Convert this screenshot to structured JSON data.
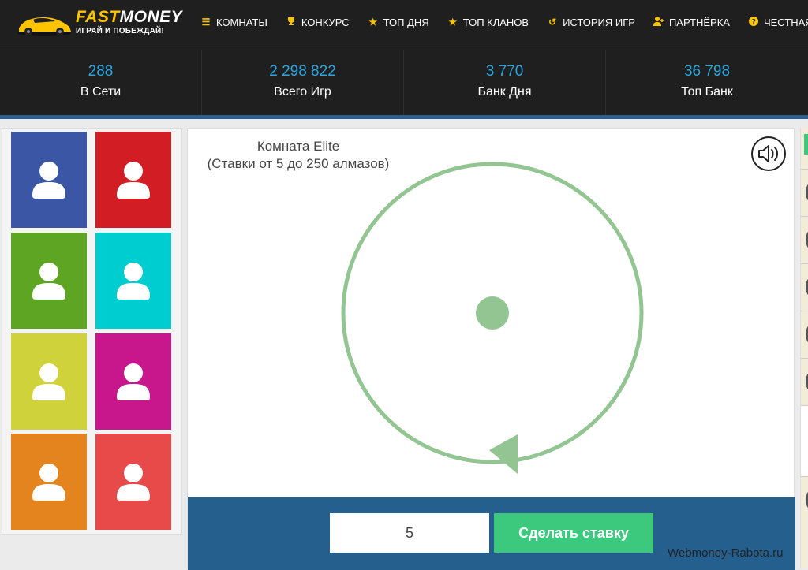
{
  "header": {
    "logo_title_a": "FAST",
    "logo_title_b": "MONEY",
    "logo_subtitle": "ИГРАЙ И ПОБЕЖДАЙ!",
    "nav": [
      {
        "label": "КОМНАТЫ",
        "icon": "menu-icon"
      },
      {
        "label": "КОНКУРС",
        "icon": "trophy-icon"
      },
      {
        "label": "ТОП ДНЯ",
        "icon": "star-icon"
      },
      {
        "label": "ТОП КЛАНОВ",
        "icon": "star-icon"
      },
      {
        "label": "ИСТОРИЯ ИГР",
        "icon": "history-icon"
      },
      {
        "label": "ПАРТНЁРКА",
        "icon": "user-plus-icon"
      },
      {
        "label": "ЧЕСТНАЯ",
        "icon": "question-icon"
      }
    ]
  },
  "stats": [
    {
      "value": "288",
      "label": "В Сети"
    },
    {
      "value": "2 298 822",
      "label": "Всего Игр"
    },
    {
      "value": "3 770",
      "label": "Банк Дня"
    },
    {
      "value": "36 798",
      "label": "Топ Банк"
    }
  ],
  "players": {
    "tiles": [
      {
        "color": "#3a56a5"
      },
      {
        "color": "#d21d24"
      },
      {
        "color": "#5da523"
      },
      {
        "color": "#00cdd0"
      },
      {
        "color": "#cfd23b"
      },
      {
        "color": "#c8168d"
      },
      {
        "color": "#e3841e"
      },
      {
        "color": "#e84a49"
      }
    ]
  },
  "game": {
    "room_name": "Комната Elite",
    "room_limits": "(Ставки от 5 до 250 алмазов)",
    "wheel_color": "#93c593",
    "bet_value": "5",
    "bet_button": "Сделать ставку"
  },
  "colors": {
    "accent_yellow": "#ffc400",
    "stat_blue": "#2aa6e0",
    "bet_bar": "#255f8e",
    "bet_green": "#3cc87d"
  },
  "watermark": "Webmoney-Rabota.ru"
}
